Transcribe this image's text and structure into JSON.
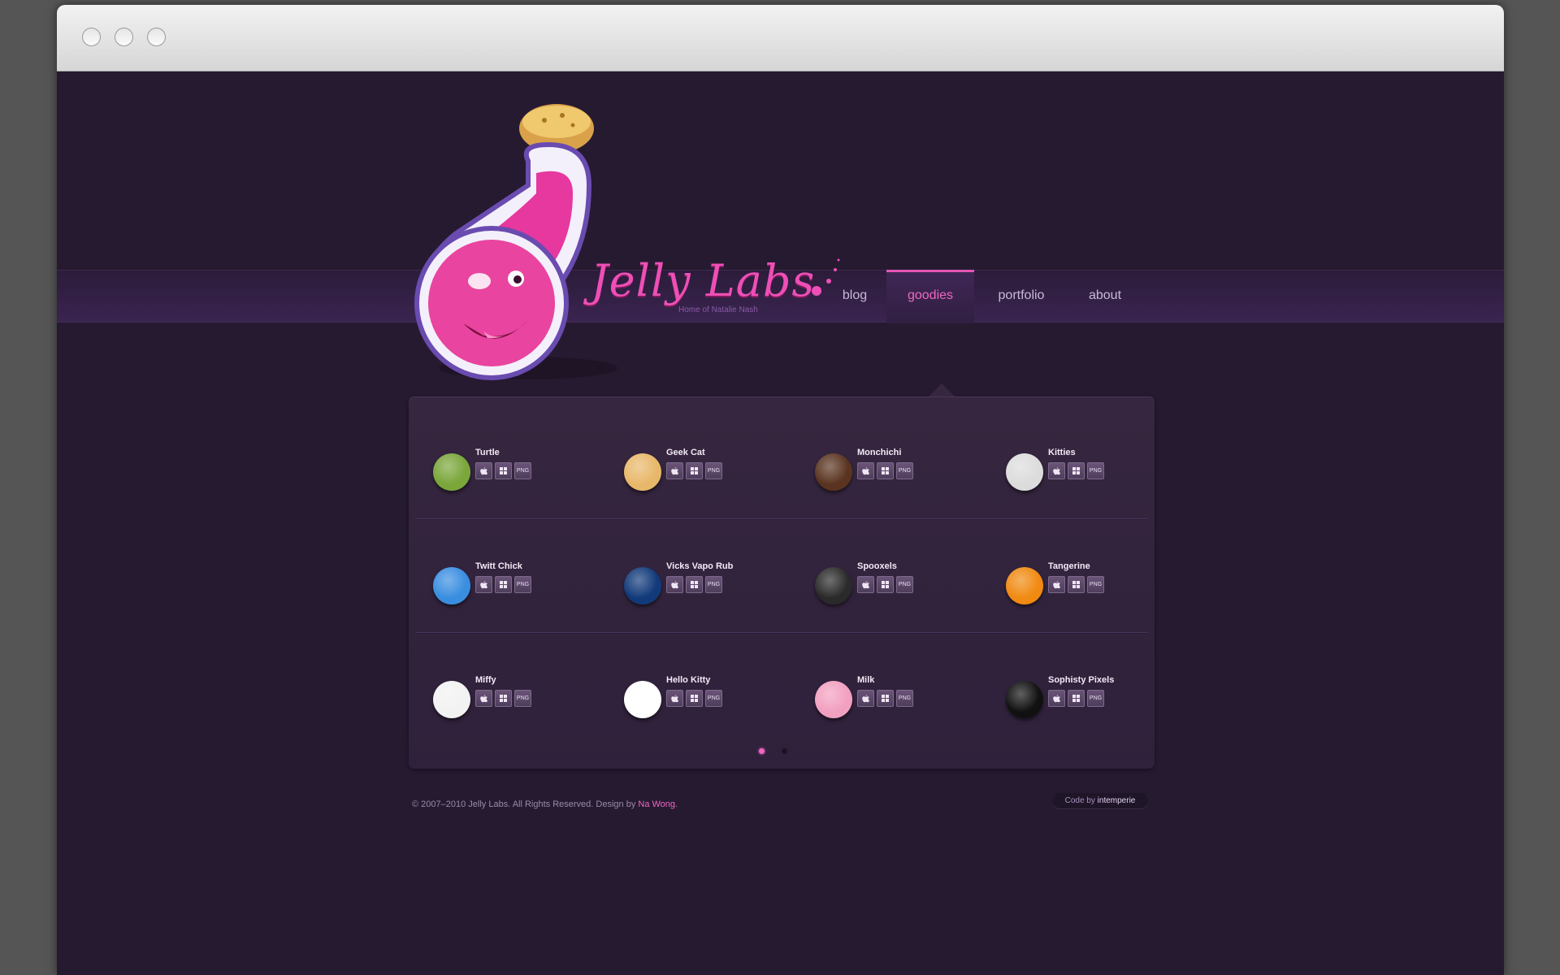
{
  "browser": {
    "buttons": [
      "close",
      "minimize",
      "zoom"
    ]
  },
  "site": {
    "logo_text": "Jelly Labs",
    "logo_tagline": "Home of Natalie Nash"
  },
  "nav": [
    {
      "label": "blog",
      "active": false
    },
    {
      "label": "goodies",
      "active": true
    },
    {
      "label": "portfolio",
      "active": false
    },
    {
      "label": "about",
      "active": false
    }
  ],
  "download_labels": {
    "mac": "apple-icon",
    "windows": "windows-icon",
    "png": "PNG"
  },
  "goodies": [
    {
      "name": "Turtle",
      "icon": "turtle-icon",
      "color": "#7aa63a"
    },
    {
      "name": "Geek Cat",
      "icon": "geek-cat-icon",
      "color": "#e8b86a"
    },
    {
      "name": "Monchichi",
      "icon": "monchichi-icon",
      "color": "#5a3420"
    },
    {
      "name": "Kitties",
      "icon": "kitties-icon",
      "color": "#dcdcdc"
    },
    {
      "name": "Twitt Chick",
      "icon": "twitt-chick-icon",
      "color": "#3a8ee0"
    },
    {
      "name": "Vicks Vapo Rub",
      "icon": "vicks-icon",
      "color": "#123a7a"
    },
    {
      "name": "Spooxels",
      "icon": "cauldron-icon",
      "color": "#2a2a2a"
    },
    {
      "name": "Tangerine",
      "icon": "tangerine-icon",
      "color": "#f08a12"
    },
    {
      "name": "Miffy",
      "icon": "miffy-icon",
      "color": "#f2f2f2"
    },
    {
      "name": "Hello Kitty",
      "icon": "hello-kitty-icon",
      "color": "#ffffff"
    },
    {
      "name": "Milk",
      "icon": "milk-icon",
      "color": "#f2a0c0"
    },
    {
      "name": "Sophisty Pixels",
      "icon": "sunglasses-icon",
      "color": "#111111"
    }
  ],
  "pagination": {
    "pages": 2,
    "current": 1
  },
  "footer": {
    "copyright": "© 2007–2010 Jelly Labs. All Rights Reserved. Design by ",
    "designer": "Na Wong",
    "end": ".",
    "code_by_label": "Code by ",
    "coder": "intemperie"
  }
}
